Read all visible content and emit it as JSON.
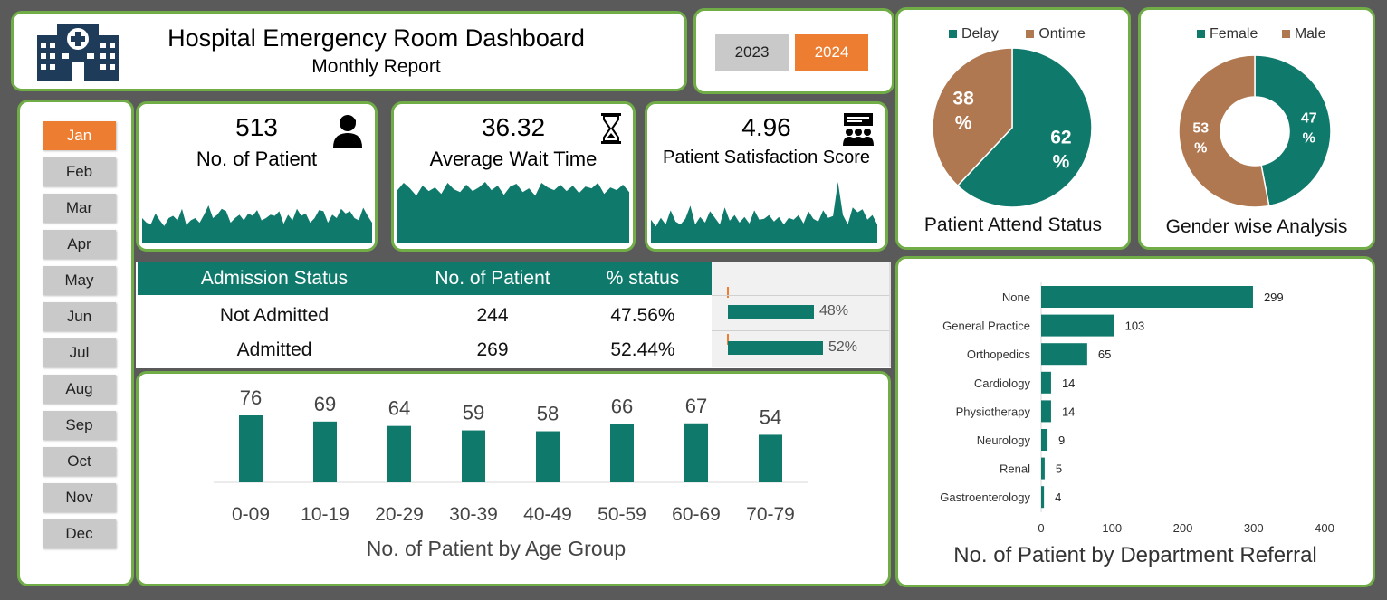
{
  "header": {
    "title": "Hospital Emergency Room Dashboard",
    "subtitle": "Monthly Report"
  },
  "years": {
    "items": [
      "2023",
      "2024"
    ],
    "selected": "2024"
  },
  "months": {
    "items": [
      "Jan",
      "Feb",
      "Mar",
      "Apr",
      "May",
      "Jun",
      "Jul",
      "Aug",
      "Sep",
      "Oct",
      "Nov",
      "Dec"
    ],
    "selected": "Jan"
  },
  "kpis": [
    {
      "value": "513",
      "label": "No. of Patient",
      "icon": "patient-icon"
    },
    {
      "value": "36.32",
      "label": "Average Wait Time",
      "icon": "hourglass-icon"
    },
    {
      "value": "4.96",
      "label": "Patient Satisfaction Score",
      "icon": "presentation-icon"
    }
  ],
  "admission": {
    "headers": [
      "Admission Status",
      "No. of Patient",
      "% status"
    ],
    "rows": [
      {
        "status": "Not Admitted",
        "count": "244",
        "pct": "47.56%",
        "bar_label": "48%",
        "fraction": 0.4756
      },
      {
        "status": "Admitted",
        "count": "269",
        "pct": "52.44%",
        "bar_label": "52%",
        "fraction": 0.5244
      }
    ]
  },
  "colors": {
    "accent": "#0f7a6c",
    "highlight": "#ed7d31",
    "brown": "#b07850",
    "border": "#70ad47"
  },
  "attend": {
    "title": "Patient Attend Status",
    "legend": [
      "Delay",
      "Ontime"
    ],
    "slices": [
      {
        "name": "Delay",
        "value": 62,
        "label": "62 %"
      },
      {
        "name": "Ontime",
        "value": 38,
        "label": "38 %"
      }
    ]
  },
  "gender": {
    "title": "Gender wise Analysis",
    "legend": [
      "Female",
      "Male"
    ],
    "slices": [
      {
        "name": "Female",
        "value": 47,
        "label": "47 %"
      },
      {
        "name": "Male",
        "value": 53,
        "label": "53 %"
      }
    ]
  },
  "chart_data": [
    {
      "type": "bar",
      "title": "No. of Patient by Age Group",
      "categories": [
        "0-09",
        "10-19",
        "20-29",
        "30-39",
        "40-49",
        "50-59",
        "60-69",
        "70-79"
      ],
      "values": [
        76,
        69,
        64,
        59,
        58,
        66,
        67,
        54
      ]
    },
    {
      "type": "bar",
      "orientation": "horizontal",
      "title": "No. of Patient by Department Referral",
      "categories": [
        "None",
        "General Practice",
        "Orthopedics",
        "Cardiology",
        "Physiotherapy",
        "Neurology",
        "Renal",
        "Gastroenterology"
      ],
      "values": [
        299,
        103,
        65,
        14,
        14,
        9,
        5,
        4
      ],
      "xlim": [
        0,
        400
      ],
      "xticks": [
        0,
        100,
        200,
        300,
        400
      ]
    }
  ],
  "sparklines": {
    "patients": [
      22,
      18,
      17,
      26,
      20,
      15,
      22,
      24,
      20,
      30,
      16,
      20,
      22,
      18,
      25,
      33,
      22,
      25,
      30,
      28,
      18,
      22,
      25,
      20,
      26,
      24,
      29,
      20,
      22,
      25,
      24,
      28,
      17,
      25,
      20,
      30,
      24,
      26,
      18,
      22,
      29,
      28,
      18,
      25,
      22,
      30,
      26,
      28,
      22,
      20,
      31,
      24,
      18
    ],
    "wait": [
      58,
      66,
      60,
      52,
      63,
      57,
      61,
      54,
      66,
      59,
      56,
      64,
      57,
      61,
      67,
      58,
      63,
      53,
      62,
      65,
      56,
      60,
      52,
      66,
      61,
      58,
      64,
      57,
      63,
      55,
      62,
      60,
      66,
      54,
      61,
      58,
      64,
      56
    ],
    "satisfaction": [
      25,
      18,
      27,
      20,
      35,
      23,
      20,
      26,
      40,
      20,
      28,
      22,
      34,
      27,
      20,
      38,
      24,
      30,
      22,
      28,
      21,
      35,
      25,
      26,
      30,
      23,
      28,
      20,
      27,
      25,
      30,
      21,
      34,
      26,
      23,
      35,
      27,
      29,
      65,
      30,
      20,
      38,
      33,
      36,
      25,
      30,
      20
    ]
  }
}
